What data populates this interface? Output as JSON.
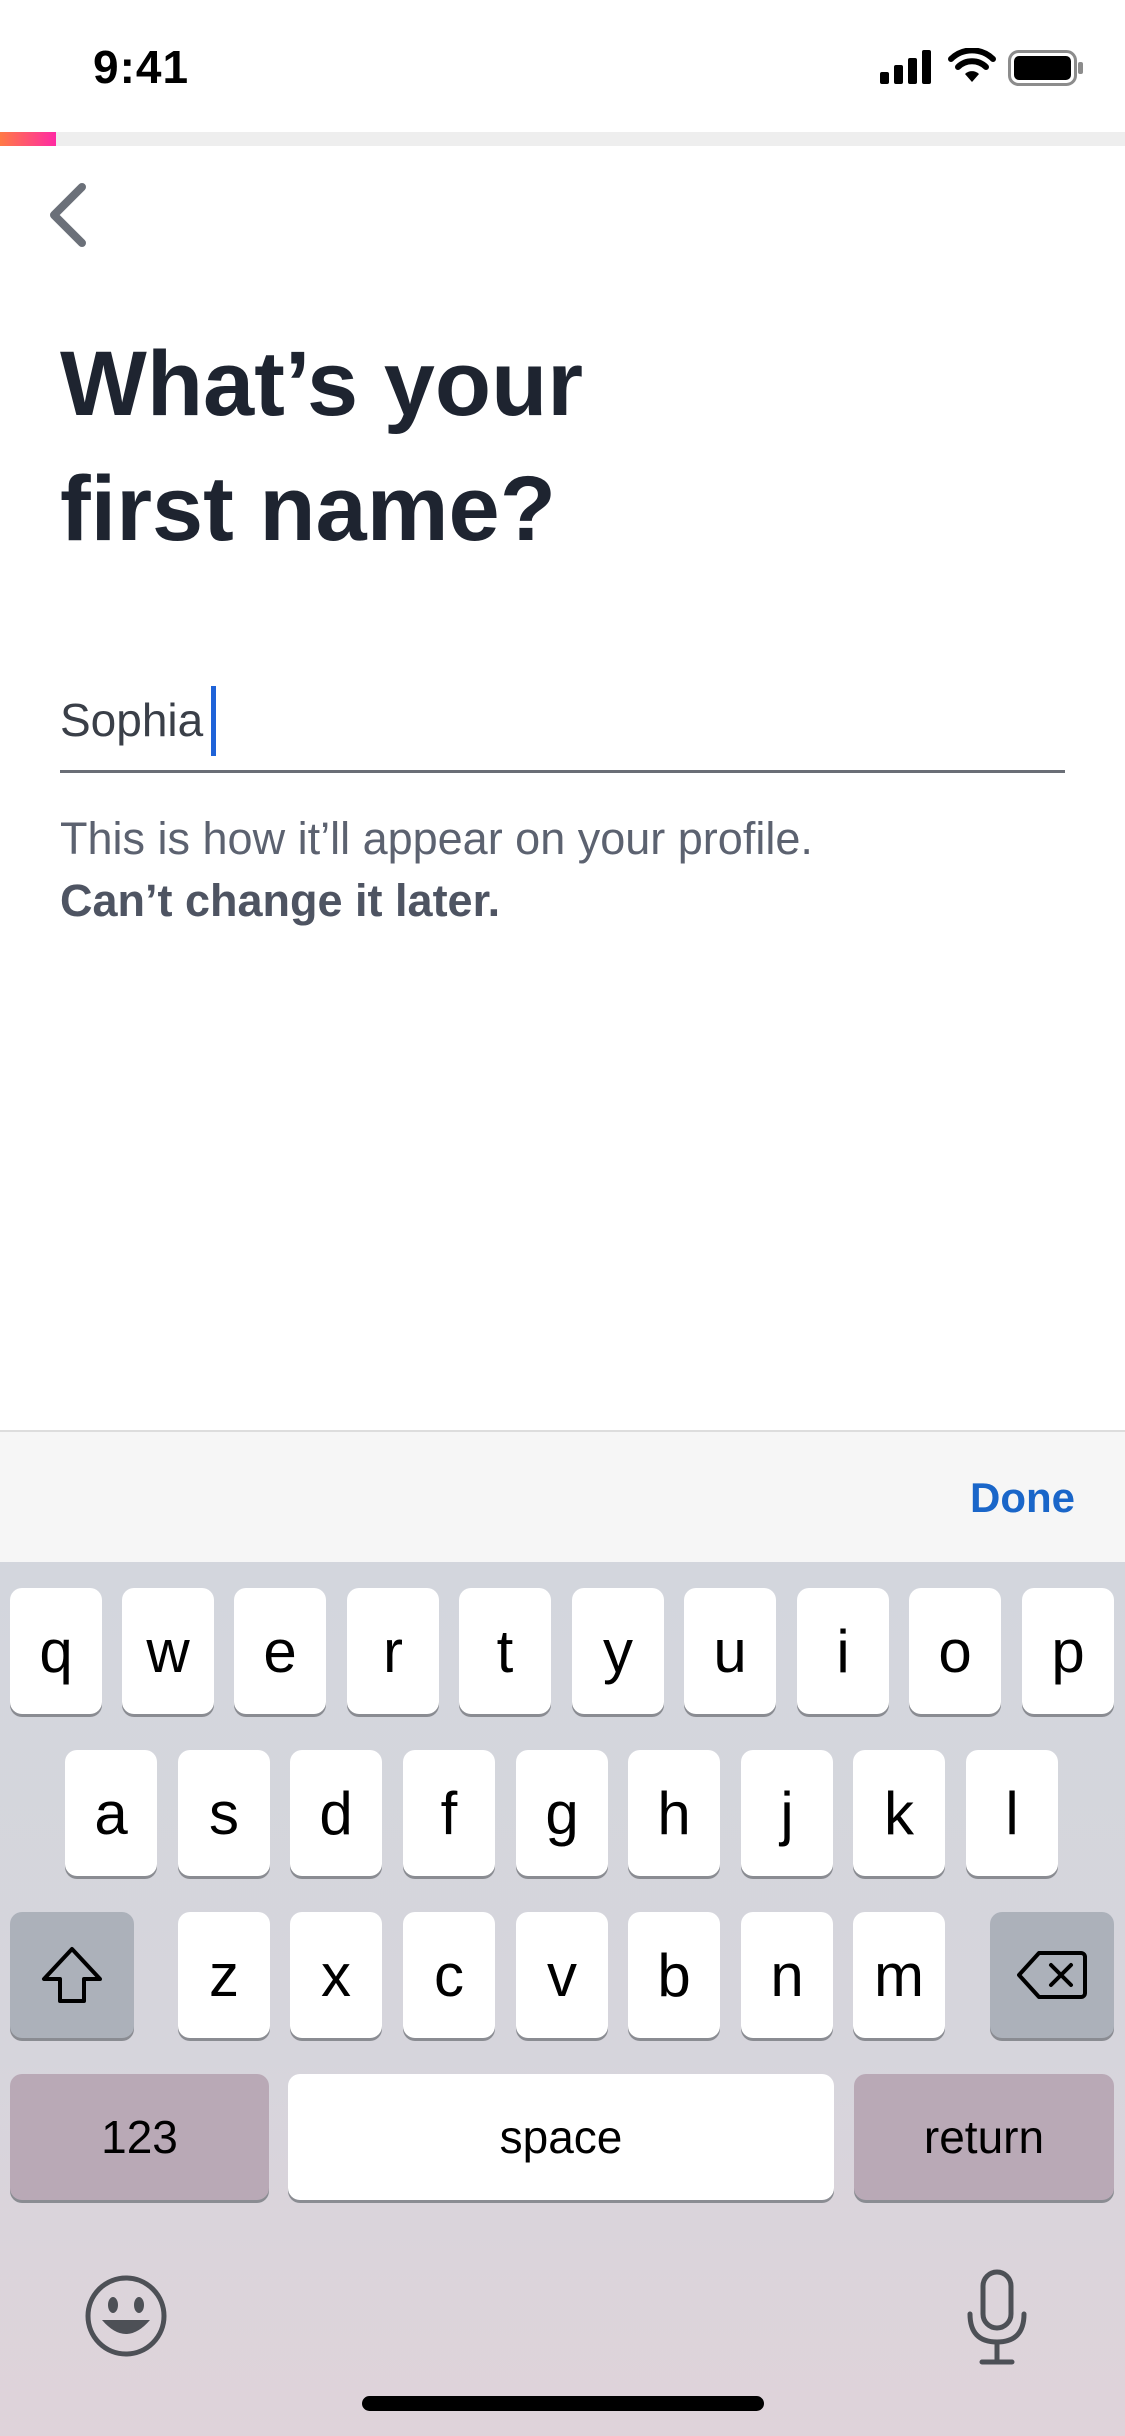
{
  "status_bar": {
    "time": "9:41"
  },
  "progress": {
    "value": 0.05,
    "color_start": "#ff7a45",
    "color_end": "#ff2aa3"
  },
  "header": {
    "title": "What’s your\nfirst name?"
  },
  "name_field": {
    "value": "Sophia",
    "placeholder": ""
  },
  "helper": {
    "line1": "This is how it’ll appear on your profile.",
    "line2": "Can’t change it later."
  },
  "accessory": {
    "done_label": "Done"
  },
  "keyboard": {
    "row1": [
      "q",
      "w",
      "e",
      "r",
      "t",
      "y",
      "u",
      "i",
      "o",
      "p"
    ],
    "row2": [
      "a",
      "s",
      "d",
      "f",
      "g",
      "h",
      "j",
      "k",
      "l"
    ],
    "row3": [
      "z",
      "x",
      "c",
      "v",
      "b",
      "n",
      "m"
    ],
    "numbers_label": "123",
    "space_label": "space",
    "return_label": "return"
  },
  "icons": [
    "signal-icon",
    "wifi-icon",
    "battery-icon",
    "back-chevron-icon",
    "shift-icon",
    "backspace-icon",
    "emoji-icon",
    "microphone-icon"
  ],
  "colors": {
    "accent": "#1a66c9",
    "caret": "#1f63d8",
    "title": "#1e2430"
  }
}
